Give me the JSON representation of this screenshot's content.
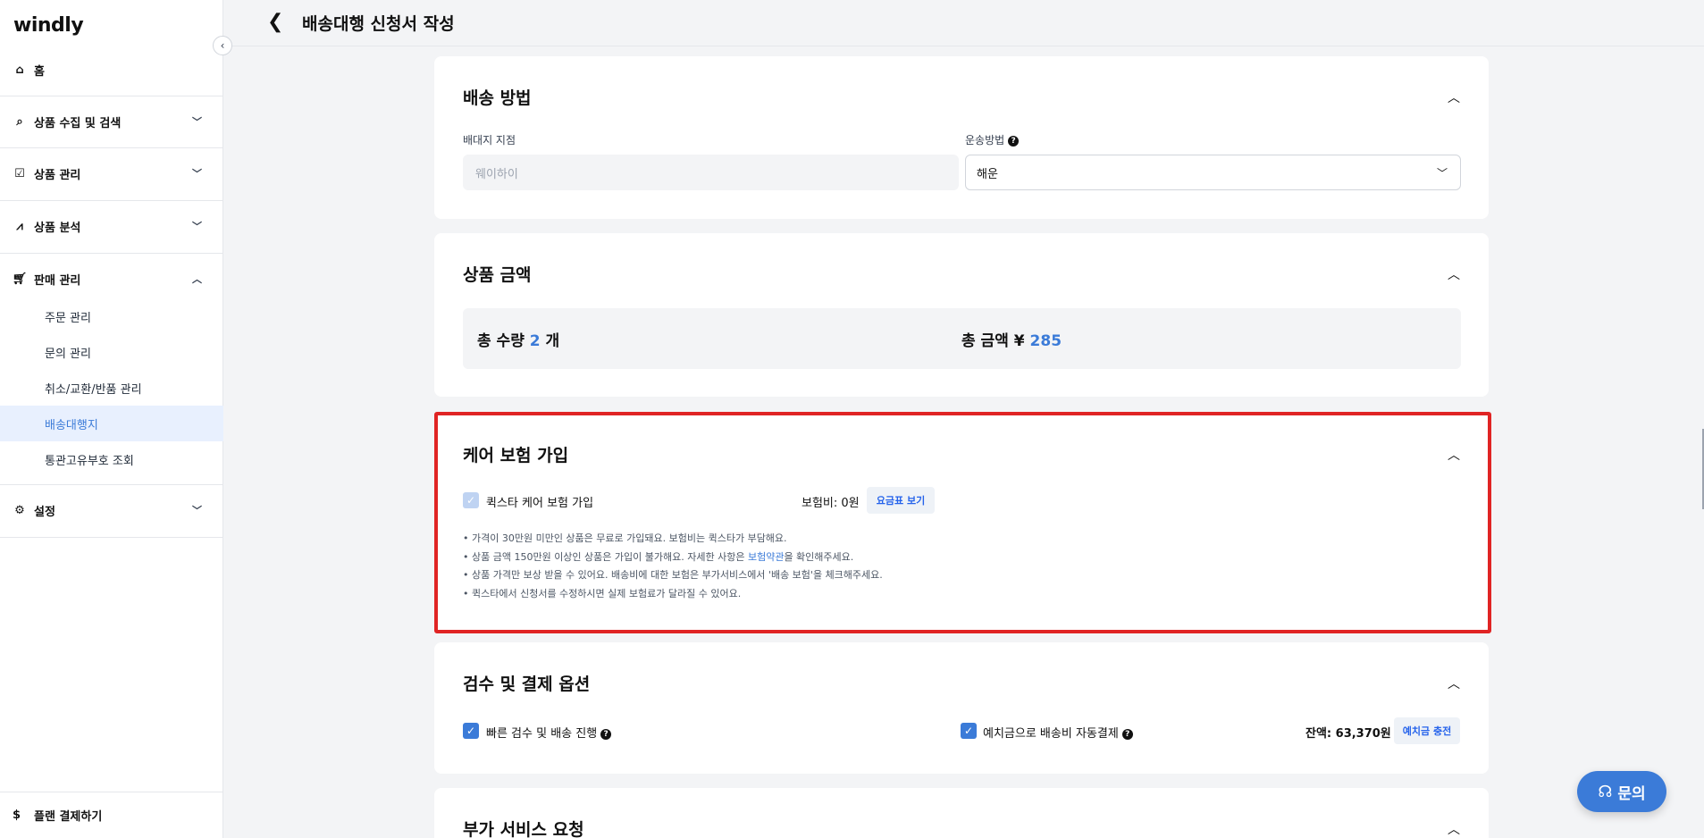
{
  "sidebar": {
    "logo": "windly",
    "home": "홈",
    "groups": [
      {
        "label": "상품 수집 및 검색",
        "icon": "search-icon"
      },
      {
        "label": "상품 관리",
        "icon": "checklist-icon"
      },
      {
        "label": "상품 분석",
        "icon": "chart-icon"
      },
      {
        "label": "판매 관리",
        "icon": "cart-icon"
      }
    ],
    "sub_items": [
      "주문 관리",
      "문의 관리",
      "취소/교환/반품 관리",
      "배송대행지",
      "통관고유부호 조회"
    ],
    "active_sub": "배송대행지",
    "settings": "설정",
    "plan_pay": "플랜 결제하기"
  },
  "header": {
    "title": "배송대행 신청서 작성"
  },
  "shipping": {
    "title": "배송 방법",
    "branch_label": "배대지 지점",
    "branch_placeholder": "웨이하이",
    "method_label": "운송방법",
    "method_value": "해운"
  },
  "amount": {
    "title": "상품 금액",
    "qty_label": "총 수량",
    "qty_value": "2",
    "qty_unit": "개",
    "total_label": "총 금액",
    "currency": "¥",
    "total_value": "285"
  },
  "insurance": {
    "title": "케어 보험 가입",
    "checkbox_label": "퀵스타 케어 보험 가입",
    "fee_text": "보험비: 0원",
    "rate_button": "요금표 보기",
    "note1": "• 가격이 30만원 미만인 상품은 무료로 가입돼요. 보험비는 퀵스타가 부담해요.",
    "note2_pre": "• 상품 금액 150만원 이상인 상품은 가입이 불가해요. 자세한 사항은 ",
    "note2_link": "보험약관",
    "note2_post": "을 확인해주세요.",
    "note3": "• 상품 가격만 보상 받을 수 있어요. 배송비에 대한 보험은 부가서비스에서 '배송 보험'을 체크해주세요.",
    "note4": "• 퀵스타에서 신청서를 수정하시면 실제 보험료가 달라질 수 있어요."
  },
  "inspection": {
    "title": "검수 및 결제 옵션",
    "fast_label": "빠른 검수 및 배송 진행",
    "auto_pay_label": "예치금으로 배송비 자동결제",
    "balance": "잔액: 63,370원",
    "charge_button": "예치금 충전"
  },
  "extra": {
    "title": "부가 서비스 요청"
  },
  "fab": {
    "label": "문의"
  },
  "colors": {
    "accent": "#3b7bd8",
    "highlight": "#e02424"
  }
}
